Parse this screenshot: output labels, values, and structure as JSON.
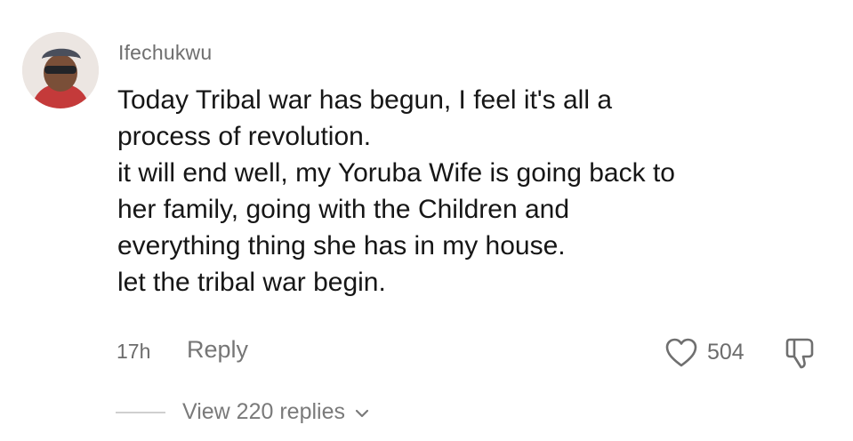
{
  "comment": {
    "username": "Ifechukwu",
    "lines": [
      "Today Tribal war has begun, I feel it's all a",
      "process of revolution.",
      "it will end well, my Yoruba Wife is going back to",
      "her family, going with the Children and",
      "everything thing she has in my house.",
      "let the tribal war begin."
    ],
    "time": "17h",
    "reply_label": "Reply",
    "like_count": "504",
    "view_replies_label": "View 220 replies"
  },
  "icons": {
    "like": "heart-outline-icon",
    "dislike": "thumbs-down-outline-icon",
    "expand": "chevron-down-icon"
  },
  "colors": {
    "text": "#161616",
    "muted": "#6c6c6c"
  }
}
